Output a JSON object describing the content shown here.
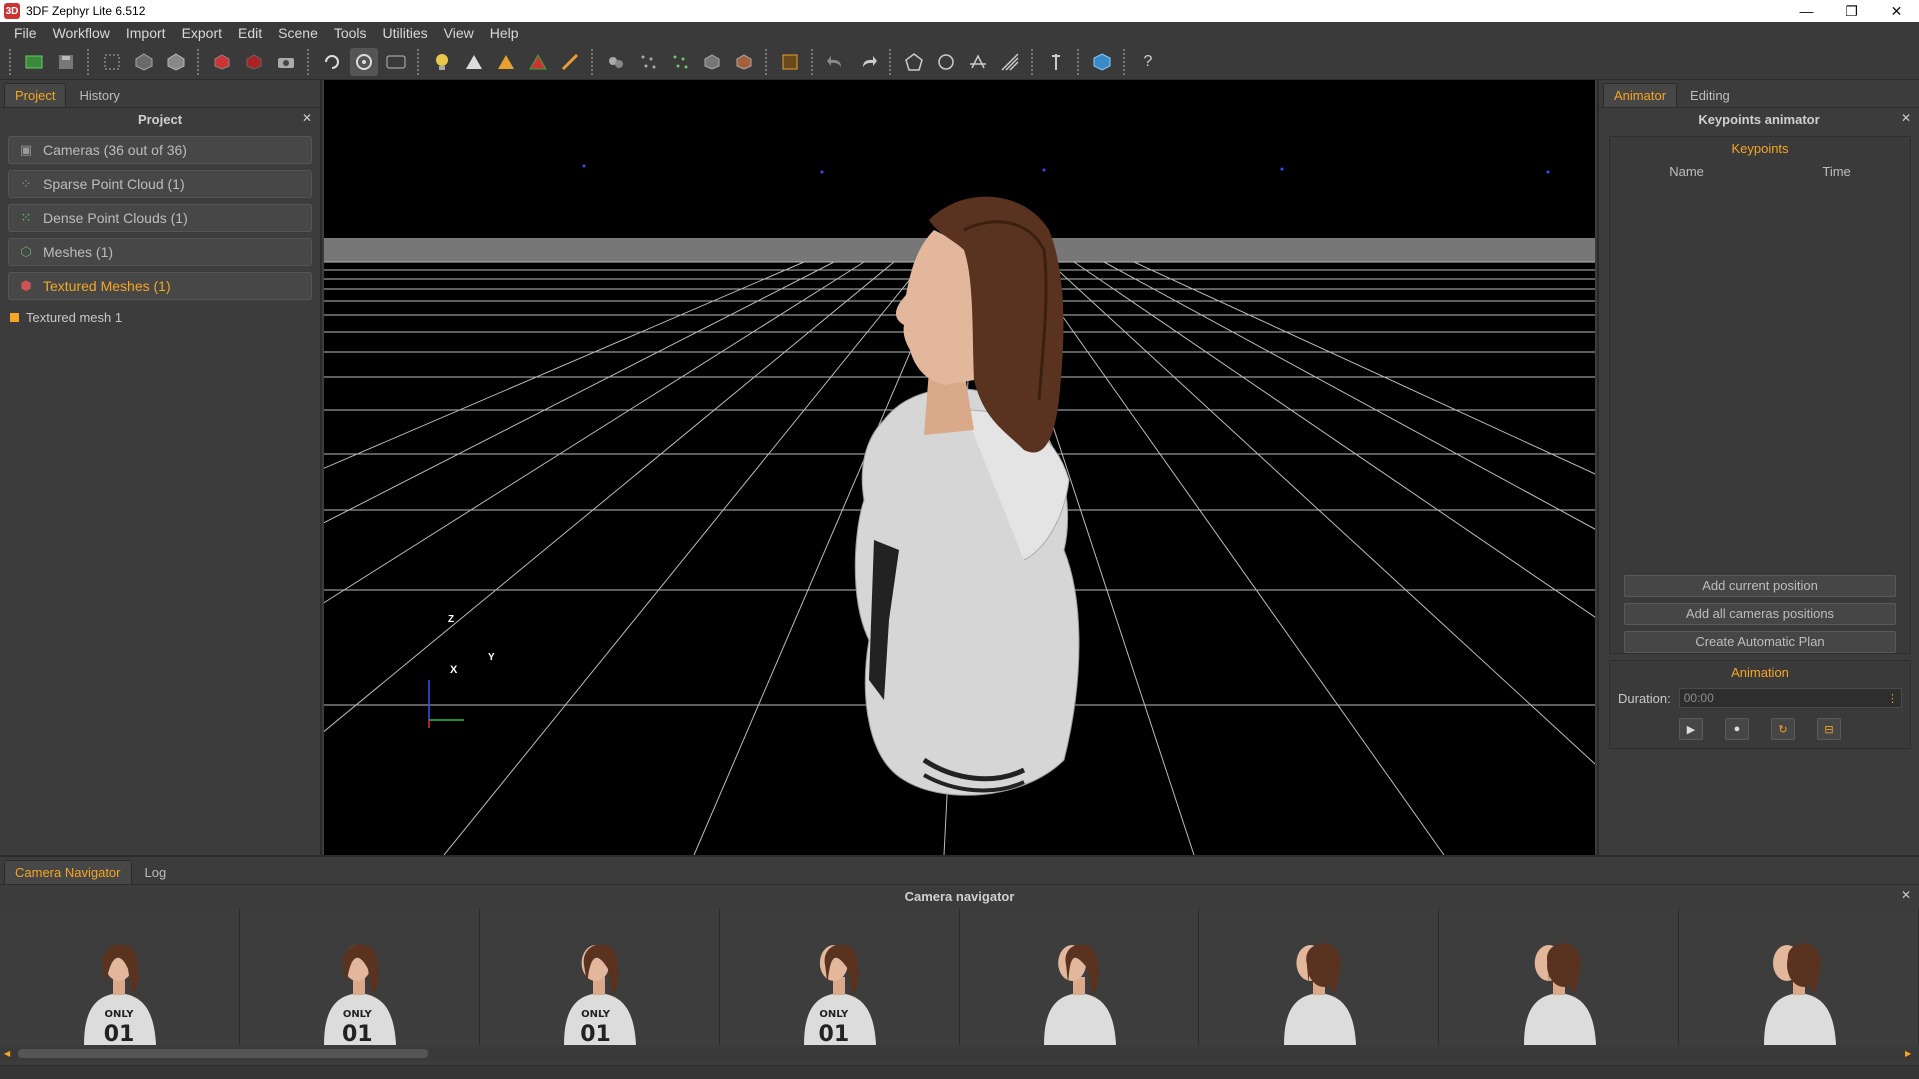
{
  "window": {
    "title": "3DF Zephyr Lite 6.512",
    "app_icon": "3D"
  },
  "window_controls": {
    "minimize": "—",
    "restore": "❐",
    "close": "✕"
  },
  "menu": [
    "File",
    "Workflow",
    "Import",
    "Export",
    "Edit",
    "Scene",
    "Tools",
    "Utilities",
    "View",
    "Help"
  ],
  "toolbar": {
    "icons": [
      "new-project-icon",
      "open-project-icon",
      "save-icon",
      "select-icon",
      "mesh-icon",
      "cube-icon",
      "red-cube-icon",
      "red-cube2-icon",
      "camera-icon",
      "orbit-icon",
      "orbit-active-icon",
      "xmesh-icon",
      "lightbulb-icon",
      "warning-icon",
      "warning2-icon",
      "color-icon",
      "brush-icon",
      "cluster-icon",
      "points-icon",
      "points2-icon",
      "box-icon",
      "mesh-box-icon",
      "bbox-icon",
      "undo-icon",
      "redo-icon",
      "polygon-icon",
      "circle-icon",
      "pin-icon",
      "ruler-icon",
      "tool-icon",
      "cube-blue-icon",
      "help-icon"
    ],
    "help_label": "?"
  },
  "left_panel": {
    "tabs": [
      "Project",
      "History"
    ],
    "active_tab": "Project",
    "header": "Project",
    "items": [
      {
        "label": "Cameras (36 out of 36)",
        "icon": "camera-icon"
      },
      {
        "label": "Sparse Point Cloud (1)",
        "icon": "sparse-cloud-icon"
      },
      {
        "label": "Dense Point Clouds (1)",
        "icon": "dense-cloud-icon"
      },
      {
        "label": "Meshes (1)",
        "icon": "mesh-icon"
      },
      {
        "label": "Textured Meshes (1)",
        "icon": "textured-mesh-icon"
      }
    ],
    "subitem": "Textured mesh 1"
  },
  "viewport": {
    "axis_labels": {
      "z": "Z",
      "y": "Y",
      "x": "X"
    }
  },
  "right_panel": {
    "tabs": [
      "Animator",
      "Editing"
    ],
    "active_tab": "Animator",
    "header": "Keypoints animator",
    "keypoints_title": "Keypoints",
    "columns": [
      "Name",
      "Time"
    ],
    "buttons": [
      "Add current position",
      "Add all cameras positions",
      "Create Automatic Plan"
    ],
    "animation_title": "Animation",
    "duration_label": "Duration:",
    "duration_value": "00:00",
    "controls": [
      "play-icon",
      "record-icon",
      "loop-icon",
      "stop-icon"
    ]
  },
  "bottom_panel": {
    "tabs": [
      "Camera Navigator",
      "Log"
    ],
    "active_tab": "Camera Navigator",
    "header": "Camera navigator",
    "thumbnail_count": 8,
    "shirt_text": "ONLY 01"
  },
  "colors": {
    "accent": "#f5a623",
    "background": "#3c3c3c",
    "viewport": "#000000"
  }
}
